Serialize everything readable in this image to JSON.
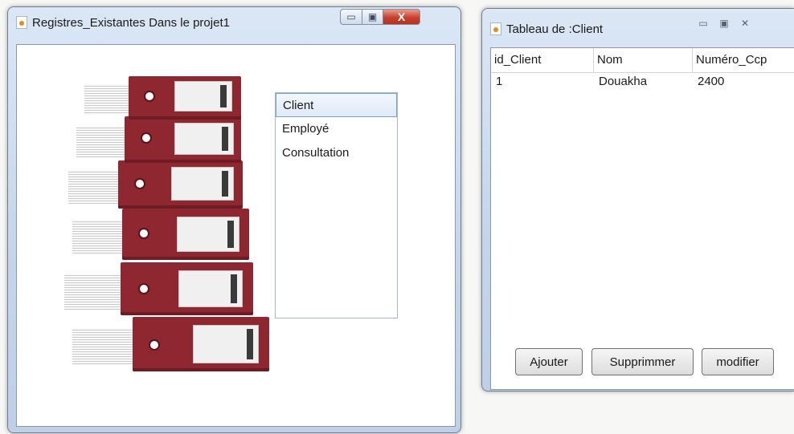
{
  "window1": {
    "title": "Registres_Existantes Dans le projet1",
    "list_items": [
      "Client",
      "Employé",
      "Consultation"
    ],
    "selected_index": 0
  },
  "window2": {
    "title": "Tableau de :Client",
    "table": {
      "columns": [
        "id_Client",
        "Nom",
        "Numéro_Ccp"
      ],
      "rows": [
        [
          "1",
          "Douakha",
          "2400"
        ]
      ]
    },
    "buttons": {
      "add": "Ajouter",
      "delete": "Supprimmer",
      "edit": "modifier"
    }
  },
  "icons": {
    "app": "java-app-icon",
    "minimize": "minimize-icon",
    "maximize": "maximize-icon",
    "close": "close-icon"
  },
  "colors": {
    "binder": "#8e2730",
    "close_button": "#c7402d",
    "selection": "#dfeaf7"
  }
}
